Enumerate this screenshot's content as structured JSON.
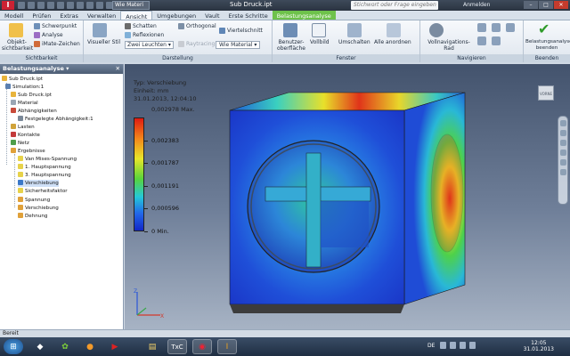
{
  "titlebar": {
    "logo": "I",
    "material": "Wie Materi",
    "title": "Sub Druck.ipt",
    "search_placeholder": "Stichwort oder Frage eingeben",
    "user": "Anmelden",
    "buttons": [
      "–",
      "□",
      "✕"
    ]
  },
  "tabs": [
    "Modell",
    "Prüfen",
    "Extras",
    "Verwalten",
    "Ansicht",
    "Umgebungen",
    "Vault",
    "Erste Schritte",
    "Belastungsanalyse"
  ],
  "active_tab": "Ansicht",
  "ribbon": {
    "sichtbarkeit": {
      "title": "Sichtbarkeit",
      "objekt": "Objekt-\nsichtbarkeit",
      "schwerpunkt": "Schwerpunkt",
      "analyse": "Analyse",
      "imate": "iMate-Zeichen"
    },
    "darstellung": {
      "title": "Darstellung",
      "visueller_stil": "Visueller Stil",
      "schatten": "Schatten",
      "reflexionen": "Reflexionen",
      "zwei_leuchten": "Zwei Leuchten",
      "orthogonal": "Orthogonal",
      "raytracing": "Raytracing",
      "viertelschnitt": "Viertelschnitt",
      "wie_material": "Wie Material"
    },
    "fenster": {
      "title": "Fenster",
      "benutzeroberflaeche": "Benutzer-\noberfläche",
      "vollbild": "Vollbild",
      "umschalten": "Umschalten",
      "alle_anordnen": "Alle anordnen"
    },
    "navigieren": {
      "title": "Navigieren",
      "vollnavigationsrad": "Vollnavigations-\nRad"
    },
    "beenden": {
      "title": "Beenden",
      "label": "Belastungsanalyse\nbeenden"
    }
  },
  "browser": {
    "title": "Belastungsanalyse ▾",
    "close": "✕",
    "items": [
      "Sub Druck.ipt",
      "Simulation:1",
      "Sub Druck.ipt",
      "Material",
      "Abhängigkeiten",
      "Festgelegte Abhängigkeit:1",
      "Lasten",
      "Kontakte",
      "Netz",
      "Ergebnisse",
      "Van Mises-Spannung",
      "1. Hauptspannung",
      "3. Hauptspannung",
      "Verschiebung",
      "Sicherheitsfaktor",
      "Spannung",
      "Verschiebung",
      "Dehnung"
    ],
    "selected_index": 13
  },
  "viewport": {
    "typ": "Typ: Verschiebung",
    "einheit": "Einheit: mm",
    "datum": "31.01.2013, 12:04:10",
    "max": "0,002978 Max.",
    "legend_values": [
      "0,002383",
      "0,001787",
      "0,001191",
      "0,000596",
      "0 Min."
    ],
    "legend_fractions": [
      0.8,
      0.6,
      0.4,
      0.2,
      0.0
    ],
    "viewcube_label": "VORNE",
    "axis_x": "X",
    "axis_z": "Z"
  },
  "statusbar": {
    "text": "Bereit"
  },
  "taskbar": {
    "lang": "DE",
    "time": "12:05",
    "date": "31.01.2013"
  },
  "colors": {
    "scale_max": "#e01a12",
    "scale_min": "#1227c8",
    "context_tab": "#6ec24b"
  }
}
